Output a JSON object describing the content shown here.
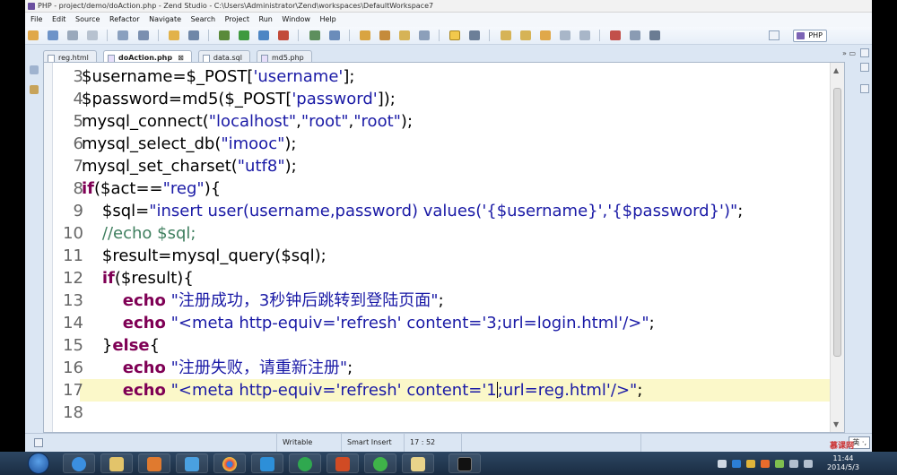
{
  "window": {
    "title": "PHP - project/demo/doAction.php - Zend Studio - C:\\Users\\Administrator\\Zend\\workspaces\\DefaultWorkspace7"
  },
  "menubar": [
    "File",
    "Edit",
    "Source",
    "Refactor",
    "Navigate",
    "Search",
    "Project",
    "Run",
    "Window",
    "Help"
  ],
  "toolbar": {
    "perspective_label": "PHP"
  },
  "tabs": [
    {
      "label": "reg.html",
      "active": false
    },
    {
      "label": "doAction.php",
      "active": true,
      "close": "⊠"
    },
    {
      "label": "data.sql",
      "active": false
    },
    {
      "label": "md5.php",
      "active": false
    }
  ],
  "tabs_controls": "»  ▭",
  "editor": {
    "current_line": 17,
    "lines": [
      {
        "n": "3",
        "tokens": [
          [
            "$username=$_POST[",
            ""
          ],
          [
            "'username'",
            "str"
          ],
          [
            "];",
            ""
          ]
        ]
      },
      {
        "n": "4",
        "tokens": [
          [
            "$password=md5($_POST[",
            ""
          ],
          [
            "'password'",
            "str"
          ],
          [
            "]);",
            ""
          ]
        ]
      },
      {
        "n": "5",
        "tokens": [
          [
            "mysql_connect(",
            ""
          ],
          [
            "\"localhost\"",
            "str"
          ],
          [
            ",",
            ""
          ],
          [
            "\"root\"",
            "str"
          ],
          [
            ",",
            ""
          ],
          [
            "\"root\"",
            "str"
          ],
          [
            ");",
            ""
          ]
        ]
      },
      {
        "n": "6",
        "tokens": [
          [
            "mysql_select_db(",
            ""
          ],
          [
            "\"imooc\"",
            "str"
          ],
          [
            ");",
            ""
          ]
        ]
      },
      {
        "n": "7",
        "tokens": [
          [
            "mysql_set_charset(",
            ""
          ],
          [
            "\"utf8\"",
            "str"
          ],
          [
            ");",
            ""
          ]
        ]
      },
      {
        "n": "8",
        "tokens": [
          [
            "if",
            "kw"
          ],
          [
            "($act==",
            ""
          ],
          [
            "\"reg\"",
            "str"
          ],
          [
            "){",
            ""
          ]
        ]
      },
      {
        "n": "9",
        "tokens": [
          [
            "    $sql=",
            ""
          ],
          [
            "\"insert user(username,password) values('{$username}','{$password}')\"",
            "str"
          ],
          [
            ";",
            ""
          ]
        ]
      },
      {
        "n": "10",
        "tokens": [
          [
            "    ",
            ""
          ],
          [
            "//echo $sql;",
            "cm"
          ]
        ]
      },
      {
        "n": "11",
        "tokens": [
          [
            "    $result=mysql_query($sql);",
            ""
          ]
        ]
      },
      {
        "n": "12",
        "tokens": [
          [
            "    ",
            ""
          ],
          [
            "if",
            "kw"
          ],
          [
            "($result){",
            ""
          ]
        ]
      },
      {
        "n": "13",
        "tokens": [
          [
            "        ",
            ""
          ],
          [
            "echo",
            "kw"
          ],
          [
            " ",
            ""
          ],
          [
            "\"注册成功，3秒钟后跳转到登陆页面\"",
            "str"
          ],
          [
            ";",
            ""
          ]
        ]
      },
      {
        "n": "14",
        "tokens": [
          [
            "        ",
            ""
          ],
          [
            "echo",
            "kw"
          ],
          [
            " ",
            ""
          ],
          [
            "\"<meta http-equiv='refresh' content='3;url=login.html'/>\"",
            "str"
          ],
          [
            ";",
            ""
          ]
        ]
      },
      {
        "n": "15",
        "tokens": [
          [
            "    }",
            ""
          ],
          [
            "else",
            "kw"
          ],
          [
            "{",
            ""
          ]
        ]
      },
      {
        "n": "16",
        "tokens": [
          [
            "        ",
            ""
          ],
          [
            "echo",
            "kw"
          ],
          [
            " ",
            ""
          ],
          [
            "\"注册失败，请重新注册\"",
            "str"
          ],
          [
            ";",
            ""
          ]
        ]
      },
      {
        "n": "17",
        "tokens": [
          [
            "        ",
            ""
          ],
          [
            "echo",
            "kw"
          ],
          [
            " ",
            ""
          ],
          [
            "\"<meta http-equiv='refresh' content='1",
            "str"
          ],
          [
            "|caret|",
            "caret"
          ],
          [
            ";url=reg.html'/>\"",
            "str"
          ],
          [
            ";",
            ""
          ]
        ]
      },
      {
        "n": "18",
        "tokens": []
      }
    ]
  },
  "statusbar": {
    "mode": "Writable",
    "insert": "Smart Insert",
    "position": "17 : 52",
    "ime": "英 ·,"
  },
  "taskbar": {
    "clock_time": "11:44",
    "clock_date": "2014/5/3"
  },
  "watermark": "慕课网",
  "colors": {
    "string": "#1a1aa6",
    "keyword": "#7f0055",
    "comment": "#3f7f5f",
    "current_line": "#fbf8c9"
  }
}
